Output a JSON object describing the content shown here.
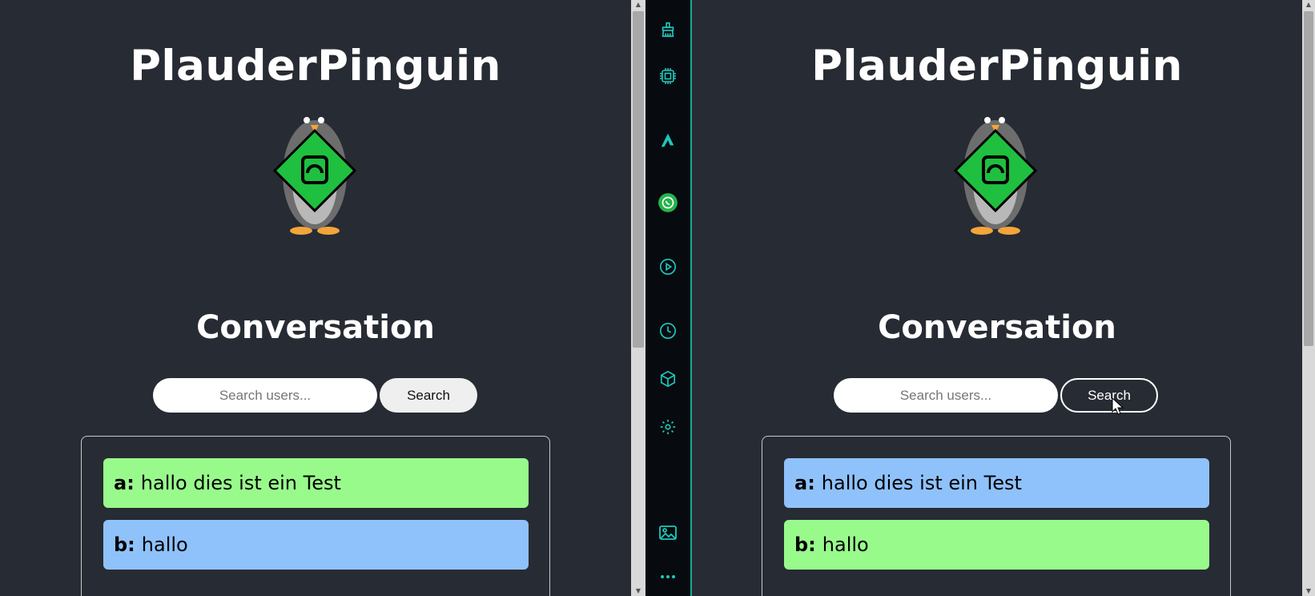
{
  "app": {
    "title": "PlauderPinguin",
    "conversation_heading": "Conversation",
    "search_placeholder": "Search users...",
    "search_button": "Search"
  },
  "panes": [
    {
      "messages": [
        {
          "sender": "a:",
          "text": "hallo dies ist ein Test",
          "color": "#99fa8c"
        },
        {
          "sender": "b:",
          "text": "hallo",
          "color": "#8fc2fb"
        }
      ]
    },
    {
      "messages": [
        {
          "sender": "a:",
          "text": "hallo dies ist ein Test",
          "color": "#8fc2fb"
        },
        {
          "sender": "b:",
          "text": "hallo",
          "color": "#99fa8c"
        }
      ]
    }
  ],
  "sidebar": {
    "icons": [
      "broom-icon",
      "chip-icon",
      "brand-logo-icon",
      "whatsapp-icon",
      "play-circle-icon",
      "clock-icon",
      "cube-icon",
      "gear-icon",
      "image-icon",
      "more-icon"
    ],
    "accent": "#1fc7bd"
  },
  "colors": {
    "background": "#272b33",
    "green_bubble": "#99fa8c",
    "blue_bubble": "#8fc2fb"
  }
}
